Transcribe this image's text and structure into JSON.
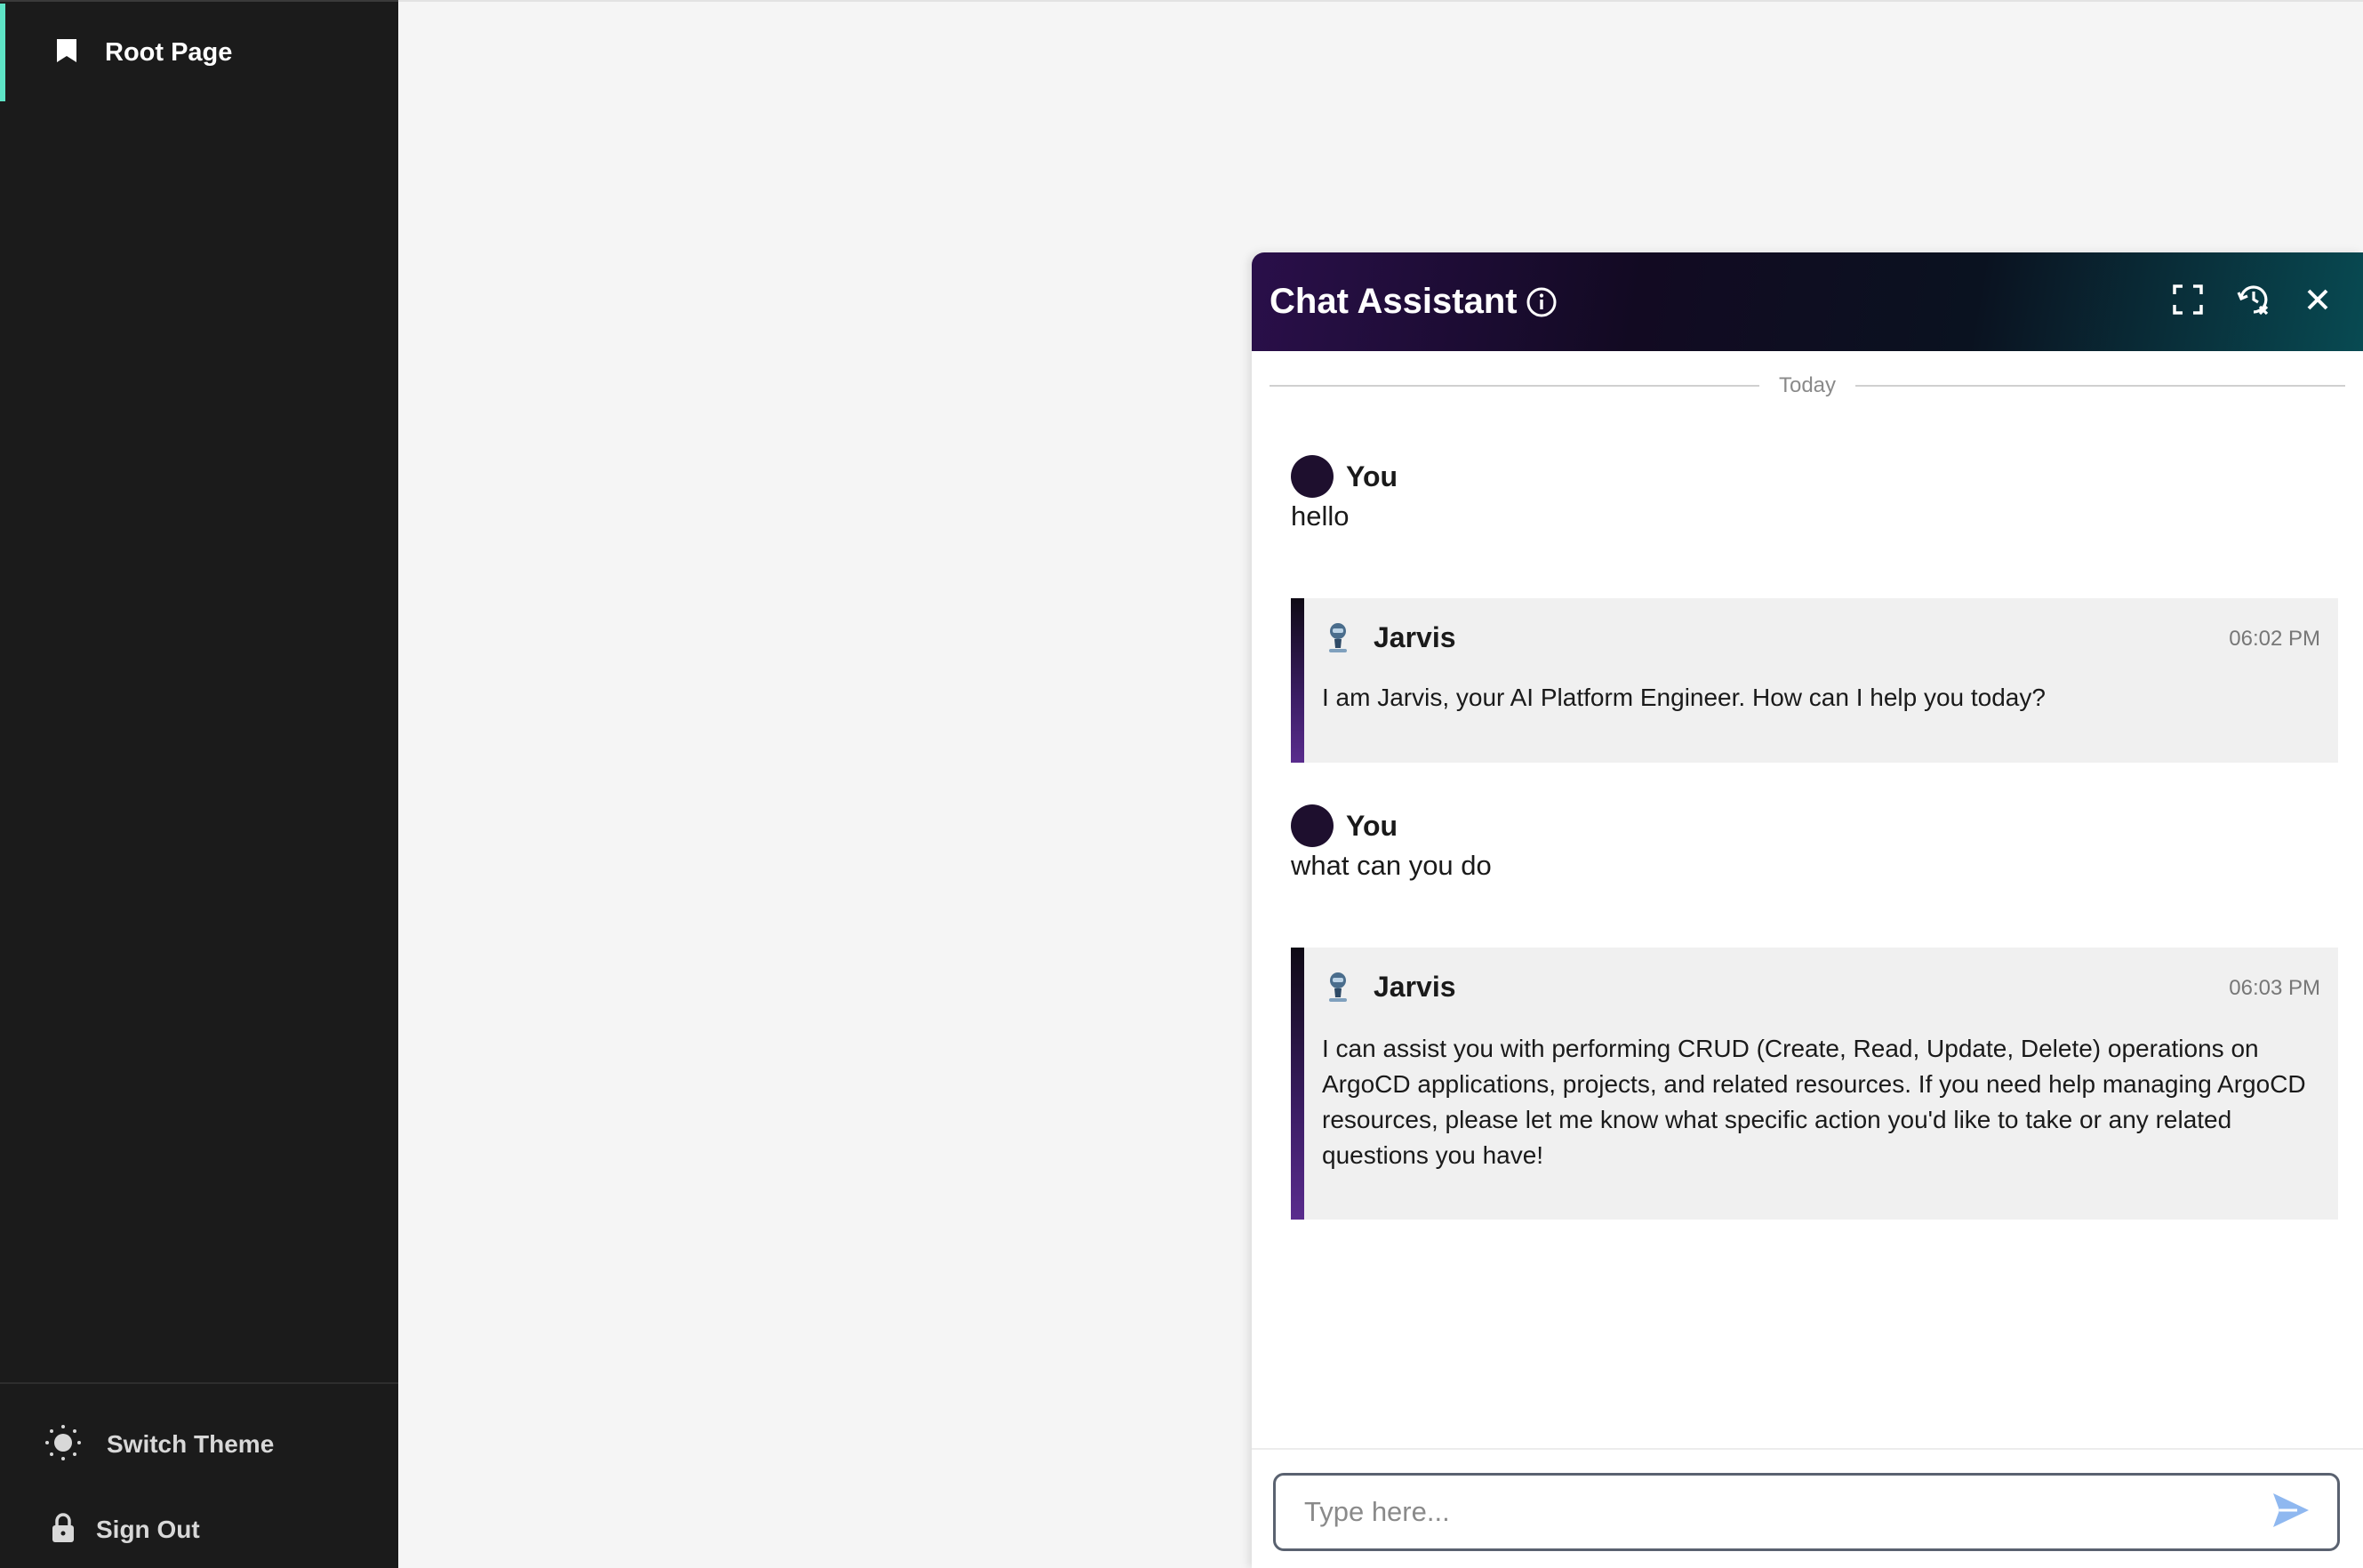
{
  "sidebar": {
    "nav_items": [
      {
        "label": "Root Page",
        "icon": "bookmark-icon",
        "active": true
      }
    ],
    "bottom": {
      "switch_theme_label": "Switch Theme",
      "sign_out_label": "Sign Out"
    }
  },
  "chat": {
    "title": "Chat Assistant",
    "date_separator": "Today",
    "messages": [
      {
        "author": "You",
        "text": "hello"
      },
      {
        "author": "Jarvis",
        "time": "06:02 PM",
        "text": "I am Jarvis, your AI Platform Engineer. How can I help you today?"
      },
      {
        "author": "You",
        "text": "what can you do"
      },
      {
        "author": "Jarvis",
        "time": "06:03 PM",
        "text": "I can assist you with performing CRUD (Create, Read, Update, Delete) operations on ArgoCD applications, projects, and related resources. If you need help managing ArgoCD resources, please let me know what specific action you'd like to take or any related questions you have!"
      }
    ],
    "input_placeholder": "Type here..."
  },
  "colors": {
    "sidebar_bg": "#1b1b1b",
    "active_accent": "#5ee4c6",
    "header_gradient_start": "#2a0f4a",
    "header_gradient_end": "#084a52",
    "bot_accent": "#3b1d64",
    "send_icon": "#8fb8f0"
  }
}
